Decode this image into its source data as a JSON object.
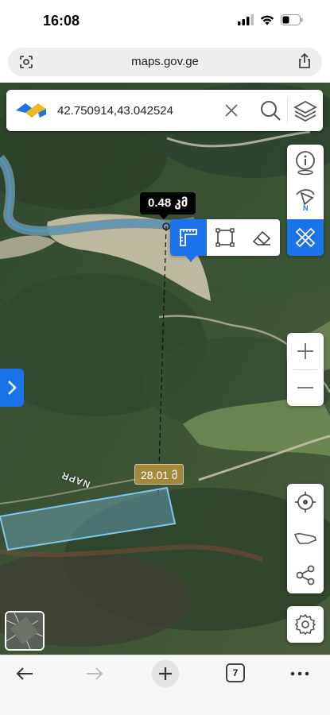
{
  "status_bar": {
    "time": "16:08"
  },
  "browser": {
    "url": "maps.gov.ge",
    "tabs_count": "7"
  },
  "search": {
    "value": "42.750914,43.042524"
  },
  "map": {
    "road_label": "NAPR",
    "ruler_label": "0.48 კმ",
    "distance_label": "28.01 მ"
  },
  "colors": {
    "accent": "#1a73e8",
    "measure_badge": "#a88c3c",
    "polygon": "#7ec8f0"
  },
  "icons": {
    "search_logo": "napr-logo-icon",
    "clear": "close-icon",
    "search": "search-icon",
    "layers": "layers-icon",
    "info": "info-icon",
    "compass": "compass-icon",
    "measure": "ruler-pencil-icon",
    "zoom_in": "plus-icon",
    "zoom_out": "minus-icon",
    "locate": "crosshair-icon",
    "georgia": "georgia-map-icon",
    "share": "share-icon",
    "settings": "gear-icon"
  }
}
